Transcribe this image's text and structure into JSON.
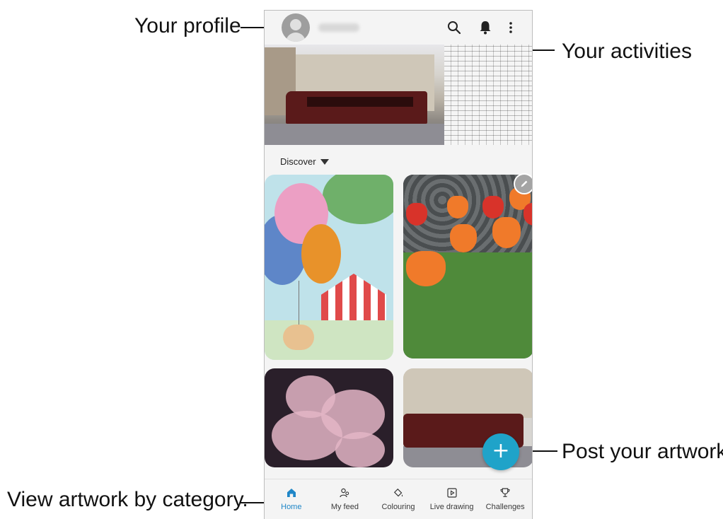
{
  "callouts": {
    "profile": "Your profile",
    "activities": "Your activities",
    "post": "Post your artwork.",
    "category": "View artwork by category."
  },
  "appbar": {
    "icons": [
      "search-icon",
      "bell-icon",
      "more-vert-icon"
    ]
  },
  "discover": {
    "label": "Discover"
  },
  "fab": {
    "icon": "+"
  },
  "nav": {
    "items": [
      {
        "label": "Home",
        "icon": "home-icon",
        "active": true
      },
      {
        "label": "My feed",
        "icon": "people-icon",
        "active": false
      },
      {
        "label": "Colouring",
        "icon": "paint-bucket-icon",
        "active": false
      },
      {
        "label": "Live drawing",
        "icon": "play-icon",
        "active": false
      },
      {
        "label": "Challenges",
        "icon": "trophy-icon",
        "active": false
      }
    ]
  },
  "colors": {
    "accent": "#1fa3c9",
    "nav_active": "#1f86c7"
  }
}
